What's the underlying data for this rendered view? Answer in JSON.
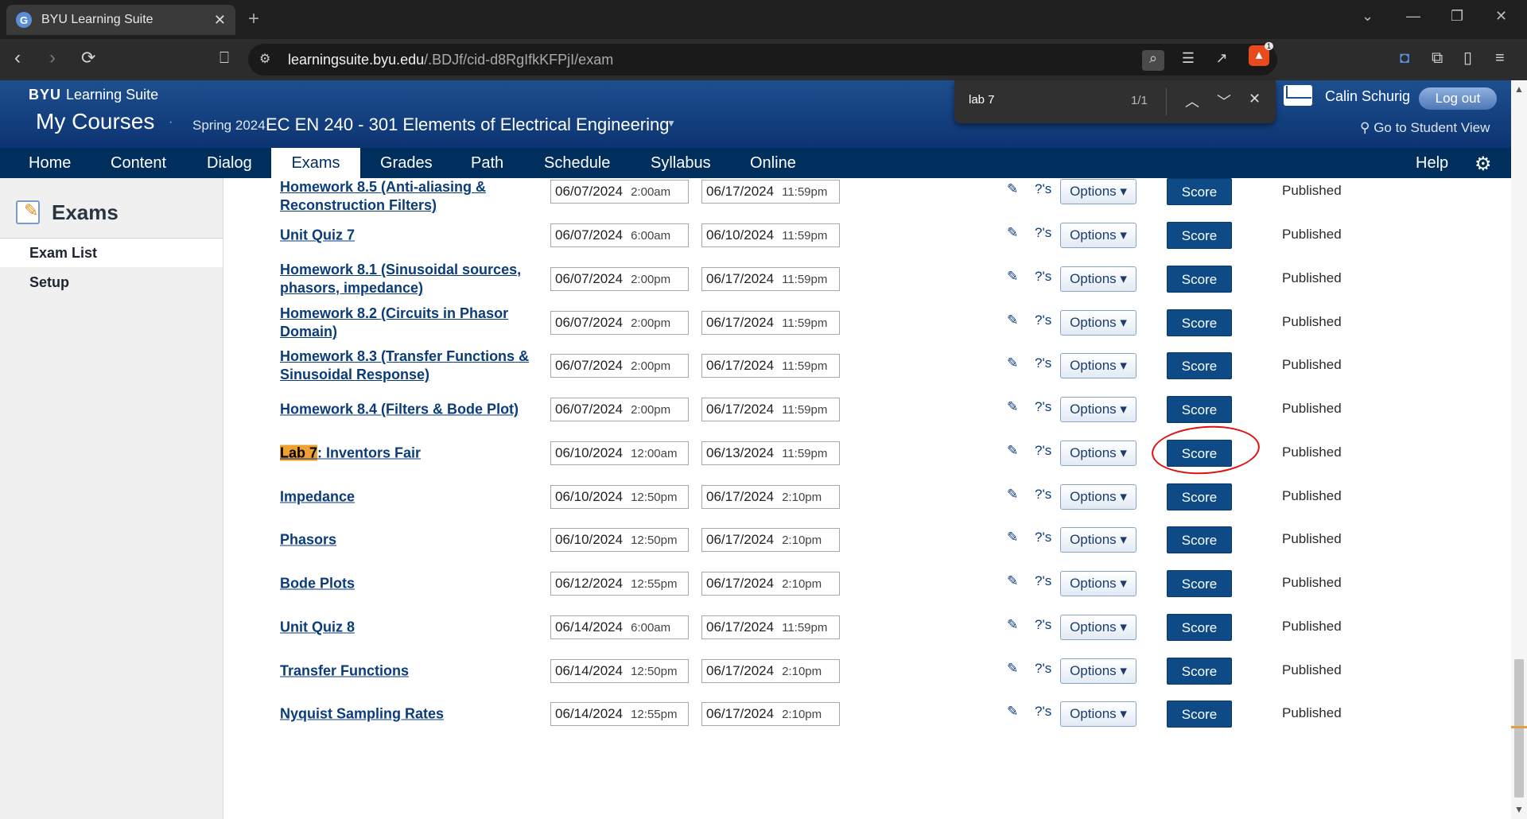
{
  "browser": {
    "tab_title": "BYU Learning Suite",
    "tab_favicon": "G",
    "url_domain": "learningsuite.byu.edu",
    "url_path": "/.BDJf/cid-d8RgIfkKFPjI/exam",
    "brave_badge": "1"
  },
  "find": {
    "query": "lab 7",
    "count": "1/1"
  },
  "header": {
    "brand_byu": "BYU",
    "brand_suite": "Learning Suite",
    "my_courses": "My Courses",
    "semester": "Spring 2024",
    "course": "EC EN 240 - 301 Elements of Electrical Engineering",
    "user": "Calin Schurig",
    "logout": "Log out",
    "student_view": "Go to Student View"
  },
  "nav": {
    "home": "Home",
    "content": "Content",
    "dialog": "Dialog",
    "exams": "Exams",
    "grades": "Grades",
    "path": "Path",
    "schedule": "Schedule",
    "syllabus": "Syllabus",
    "online": "Online",
    "help": "Help"
  },
  "sidebar": {
    "title": "Exams",
    "items": [
      "Exam List",
      "Setup"
    ]
  },
  "labels": {
    "options": "Options ▾",
    "score": "Score",
    "questions": "?'s"
  },
  "rows": [
    {
      "title": "Homework 8.5 (Anti-aliasing & Reconstruction Filters)",
      "start_date": "06/07/2024",
      "start_time": "2:00am",
      "end_date": "06/17/2024",
      "end_time": "11:59pm",
      "status": "Published"
    },
    {
      "title": "Unit Quiz 7",
      "start_date": "06/07/2024",
      "start_time": "6:00am",
      "end_date": "06/10/2024",
      "end_time": "11:59pm",
      "status": "Published"
    },
    {
      "title": "Homework 8.1 (Sinusoidal sources, phasors, impedance)",
      "start_date": "06/07/2024",
      "start_time": "2:00pm",
      "end_date": "06/17/2024",
      "end_time": "11:59pm",
      "status": "Published"
    },
    {
      "title": "Homework 8.2 (Circuits in Phasor Domain)",
      "start_date": "06/07/2024",
      "start_time": "2:00pm",
      "end_date": "06/17/2024",
      "end_time": "11:59pm",
      "status": "Published"
    },
    {
      "title": "Homework 8.3 (Transfer Functions & Sinusoidal Response)",
      "start_date": "06/07/2024",
      "start_time": "2:00pm",
      "end_date": "06/17/2024",
      "end_time": "11:59pm",
      "status": "Published"
    },
    {
      "title": "Homework 8.4 (Filters & Bode Plot)",
      "start_date": "06/07/2024",
      "start_time": "2:00pm",
      "end_date": "06/17/2024",
      "end_time": "11:59pm",
      "status": "Published"
    },
    {
      "title_highlight": "Lab 7",
      "title_rest": ": Inventors Fair",
      "start_date": "06/10/2024",
      "start_time": "12:00am",
      "end_date": "06/13/2024",
      "end_time": "11:59pm",
      "status": "Published"
    },
    {
      "title": "Impedance",
      "start_date": "06/10/2024",
      "start_time": "12:50pm",
      "end_date": "06/17/2024",
      "end_time": "2:10pm",
      "status": "Published"
    },
    {
      "title": "Phasors",
      "start_date": "06/10/2024",
      "start_time": "12:50pm",
      "end_date": "06/17/2024",
      "end_time": "2:10pm",
      "status": "Published"
    },
    {
      "title": "Bode Plots",
      "start_date": "06/12/2024",
      "start_time": "12:55pm",
      "end_date": "06/17/2024",
      "end_time": "2:10pm",
      "status": "Published"
    },
    {
      "title": "Unit Quiz 8",
      "start_date": "06/14/2024",
      "start_time": "6:00am",
      "end_date": "06/17/2024",
      "end_time": "11:59pm",
      "status": "Published"
    },
    {
      "title": "Transfer Functions",
      "start_date": "06/14/2024",
      "start_time": "12:50pm",
      "end_date": "06/17/2024",
      "end_time": "2:10pm",
      "status": "Published"
    },
    {
      "title": "Nyquist Sampling Rates",
      "start_date": "06/14/2024",
      "start_time": "12:55pm",
      "end_date": "06/17/2024",
      "end_time": "2:10pm",
      "status": "Published"
    }
  ]
}
